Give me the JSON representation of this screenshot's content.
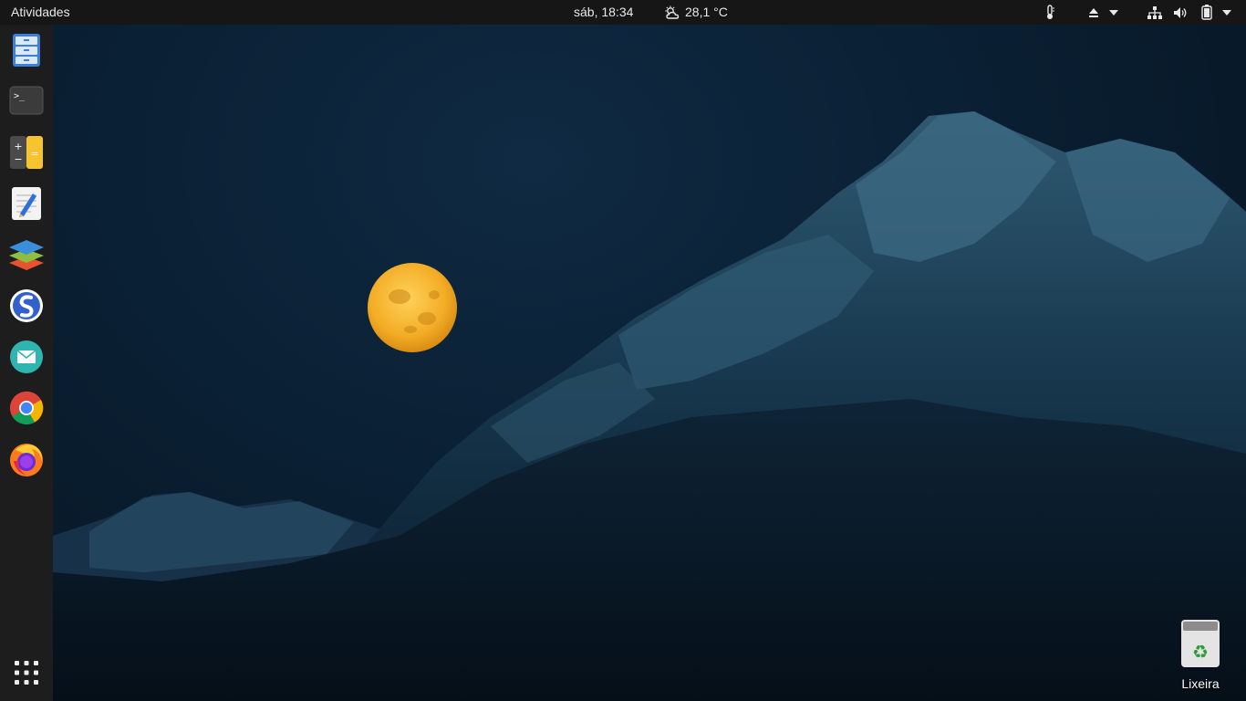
{
  "topbar": {
    "activities_label": "Atividades",
    "clock": "sáb, 18:34",
    "weather": {
      "icon": "partly-cloudy-icon",
      "temperature": "28,1 °C"
    },
    "tray": [
      "thermometer-icon",
      "eject-icon",
      "dropdown-icon",
      "network-icon",
      "volume-icon",
      "battery-icon",
      "system-menu-icon"
    ]
  },
  "dock": {
    "apps": [
      {
        "name": "files",
        "icon": "files-icon"
      },
      {
        "name": "terminal",
        "icon": "terminal-icon",
        "glyph": ">_"
      },
      {
        "name": "calculator",
        "icon": "calculator-icon"
      },
      {
        "name": "text-editor",
        "icon": "text-editor-icon"
      },
      {
        "name": "onlyoffice",
        "icon": "layers-icon"
      },
      {
        "name": "simplenote",
        "icon": "simplenote-icon"
      },
      {
        "name": "mail",
        "icon": "mail-icon"
      },
      {
        "name": "chrome",
        "icon": "chrome-icon"
      },
      {
        "name": "firefox",
        "icon": "firefox-icon"
      }
    ],
    "show_apps": "grid-icon"
  },
  "desktop": {
    "trash": {
      "label": "Lixeira",
      "icon": "recycle-icon"
    },
    "wallpaper": "full moon over snowy mountain at night"
  },
  "colors": {
    "topbar_bg": "#161616",
    "dock_bg": "#1d1d1d",
    "sky": "#0a1f33",
    "moon": "#f5b52e"
  }
}
